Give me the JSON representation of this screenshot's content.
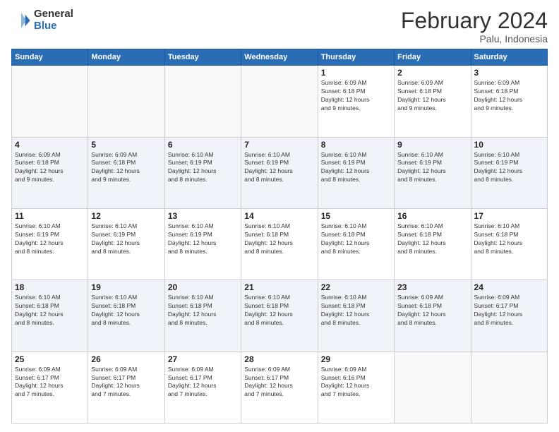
{
  "logo": {
    "general": "General",
    "blue": "Blue"
  },
  "title": "February 2024",
  "subtitle": "Palu, Indonesia",
  "days_header": [
    "Sunday",
    "Monday",
    "Tuesday",
    "Wednesday",
    "Thursday",
    "Friday",
    "Saturday"
  ],
  "weeks": [
    [
      {
        "num": "",
        "info": ""
      },
      {
        "num": "",
        "info": ""
      },
      {
        "num": "",
        "info": ""
      },
      {
        "num": "",
        "info": ""
      },
      {
        "num": "1",
        "info": "Sunrise: 6:09 AM\nSunset: 6:18 PM\nDaylight: 12 hours\nand 9 minutes."
      },
      {
        "num": "2",
        "info": "Sunrise: 6:09 AM\nSunset: 6:18 PM\nDaylight: 12 hours\nand 9 minutes."
      },
      {
        "num": "3",
        "info": "Sunrise: 6:09 AM\nSunset: 6:18 PM\nDaylight: 12 hours\nand 9 minutes."
      }
    ],
    [
      {
        "num": "4",
        "info": "Sunrise: 6:09 AM\nSunset: 6:18 PM\nDaylight: 12 hours\nand 9 minutes."
      },
      {
        "num": "5",
        "info": "Sunrise: 6:09 AM\nSunset: 6:18 PM\nDaylight: 12 hours\nand 9 minutes."
      },
      {
        "num": "6",
        "info": "Sunrise: 6:10 AM\nSunset: 6:19 PM\nDaylight: 12 hours\nand 8 minutes."
      },
      {
        "num": "7",
        "info": "Sunrise: 6:10 AM\nSunset: 6:19 PM\nDaylight: 12 hours\nand 8 minutes."
      },
      {
        "num": "8",
        "info": "Sunrise: 6:10 AM\nSunset: 6:19 PM\nDaylight: 12 hours\nand 8 minutes."
      },
      {
        "num": "9",
        "info": "Sunrise: 6:10 AM\nSunset: 6:19 PM\nDaylight: 12 hours\nand 8 minutes."
      },
      {
        "num": "10",
        "info": "Sunrise: 6:10 AM\nSunset: 6:19 PM\nDaylight: 12 hours\nand 8 minutes."
      }
    ],
    [
      {
        "num": "11",
        "info": "Sunrise: 6:10 AM\nSunset: 6:19 PM\nDaylight: 12 hours\nand 8 minutes."
      },
      {
        "num": "12",
        "info": "Sunrise: 6:10 AM\nSunset: 6:19 PM\nDaylight: 12 hours\nand 8 minutes."
      },
      {
        "num": "13",
        "info": "Sunrise: 6:10 AM\nSunset: 6:19 PM\nDaylight: 12 hours\nand 8 minutes."
      },
      {
        "num": "14",
        "info": "Sunrise: 6:10 AM\nSunset: 6:18 PM\nDaylight: 12 hours\nand 8 minutes."
      },
      {
        "num": "15",
        "info": "Sunrise: 6:10 AM\nSunset: 6:18 PM\nDaylight: 12 hours\nand 8 minutes."
      },
      {
        "num": "16",
        "info": "Sunrise: 6:10 AM\nSunset: 6:18 PM\nDaylight: 12 hours\nand 8 minutes."
      },
      {
        "num": "17",
        "info": "Sunrise: 6:10 AM\nSunset: 6:18 PM\nDaylight: 12 hours\nand 8 minutes."
      }
    ],
    [
      {
        "num": "18",
        "info": "Sunrise: 6:10 AM\nSunset: 6:18 PM\nDaylight: 12 hours\nand 8 minutes."
      },
      {
        "num": "19",
        "info": "Sunrise: 6:10 AM\nSunset: 6:18 PM\nDaylight: 12 hours\nand 8 minutes."
      },
      {
        "num": "20",
        "info": "Sunrise: 6:10 AM\nSunset: 6:18 PM\nDaylight: 12 hours\nand 8 minutes."
      },
      {
        "num": "21",
        "info": "Sunrise: 6:10 AM\nSunset: 6:18 PM\nDaylight: 12 hours\nand 8 minutes."
      },
      {
        "num": "22",
        "info": "Sunrise: 6:10 AM\nSunset: 6:18 PM\nDaylight: 12 hours\nand 8 minutes."
      },
      {
        "num": "23",
        "info": "Sunrise: 6:09 AM\nSunset: 6:18 PM\nDaylight: 12 hours\nand 8 minutes."
      },
      {
        "num": "24",
        "info": "Sunrise: 6:09 AM\nSunset: 6:17 PM\nDaylight: 12 hours\nand 8 minutes."
      }
    ],
    [
      {
        "num": "25",
        "info": "Sunrise: 6:09 AM\nSunset: 6:17 PM\nDaylight: 12 hours\nand 7 minutes."
      },
      {
        "num": "26",
        "info": "Sunrise: 6:09 AM\nSunset: 6:17 PM\nDaylight: 12 hours\nand 7 minutes."
      },
      {
        "num": "27",
        "info": "Sunrise: 6:09 AM\nSunset: 6:17 PM\nDaylight: 12 hours\nand 7 minutes."
      },
      {
        "num": "28",
        "info": "Sunrise: 6:09 AM\nSunset: 6:17 PM\nDaylight: 12 hours\nand 7 minutes."
      },
      {
        "num": "29",
        "info": "Sunrise: 6:09 AM\nSunset: 6:16 PM\nDaylight: 12 hours\nand 7 minutes."
      },
      {
        "num": "",
        "info": ""
      },
      {
        "num": "",
        "info": ""
      }
    ]
  ]
}
